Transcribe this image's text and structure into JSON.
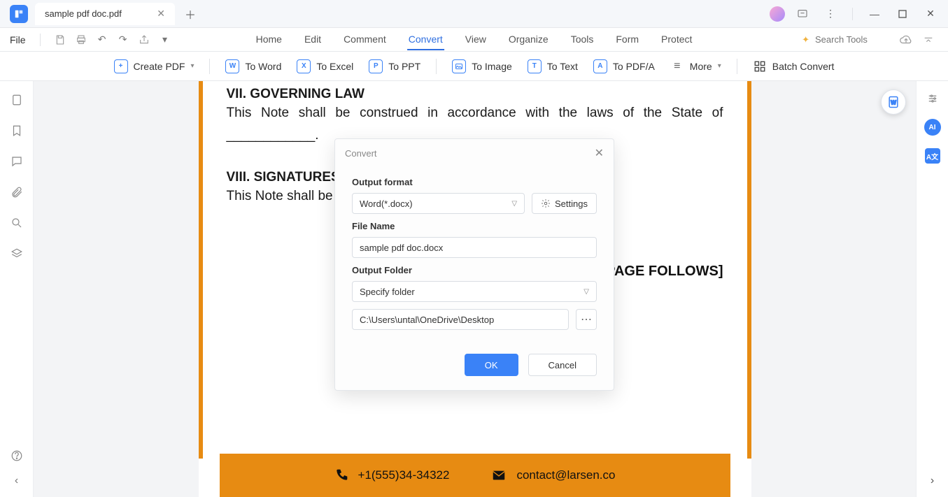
{
  "titlebar": {
    "tab_name": "sample pdf doc.pdf"
  },
  "menubar": {
    "file": "File",
    "tabs": [
      "Home",
      "Edit",
      "Comment",
      "Convert",
      "View",
      "Organize",
      "Tools",
      "Form",
      "Protect"
    ],
    "active_tab": "Convert",
    "search_placeholder": "Search Tools"
  },
  "ribbon": {
    "create_pdf": "Create PDF",
    "to_word": "To Word",
    "to_excel": "To Excel",
    "to_ppt": "To PPT",
    "to_image": "To Image",
    "to_text": "To Text",
    "to_pdfa": "To PDF/A",
    "more": "More",
    "batch": "Batch Convert"
  },
  "document": {
    "h7": "VII. GOVERNING LAW",
    "p7": "This Note shall be construed in accordance with the laws of the State of ____________.",
    "h8": "VIII. SIGNATURES",
    "p8": "This Note shall be",
    "page_follows": "PAGE FOLLOWS]",
    "footer_phone": "+1(555)34-34322",
    "footer_email": "contact@larsen.co"
  },
  "dialog": {
    "title": "Convert",
    "output_format_label": "Output format",
    "output_format_value": "Word(*.docx)",
    "settings_label": "Settings",
    "file_name_label": "File Name",
    "file_name_value": "sample pdf doc.docx",
    "output_folder_label": "Output Folder",
    "output_folder_mode": "Specify folder",
    "output_folder_path": "C:\\Users\\untal\\OneDrive\\Desktop",
    "ok": "OK",
    "cancel": "Cancel"
  }
}
